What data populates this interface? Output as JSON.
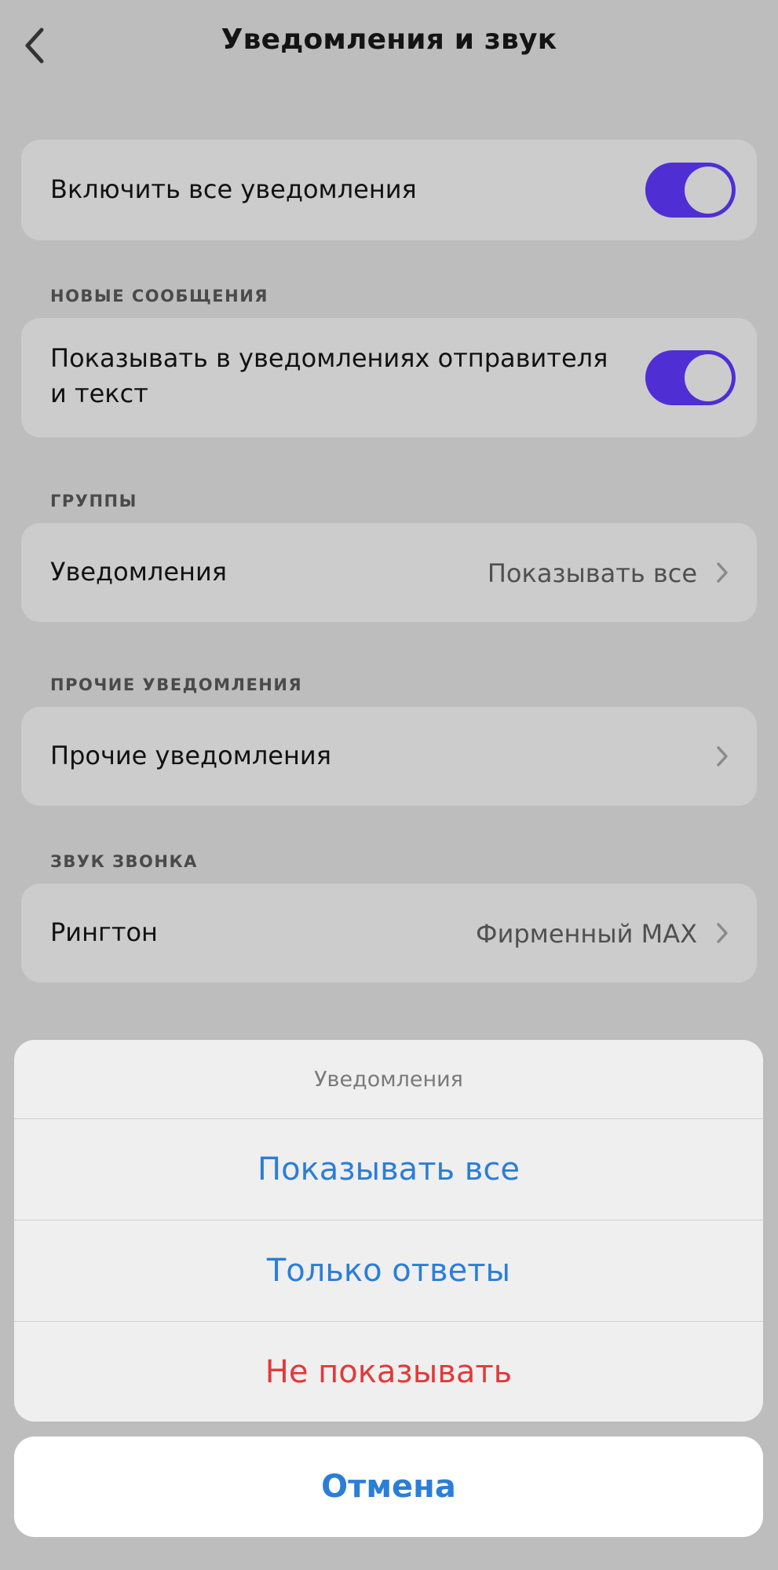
{
  "header": {
    "title": "Уведомления и звук"
  },
  "all_notifications": {
    "label": "Включить все уведомления",
    "enabled": true
  },
  "new_messages": {
    "section": "НОВЫЕ СООБЩЕНИЯ",
    "label_line1": "Показывать в уведомлениях отправителя",
    "label_line2": "и текст",
    "enabled": true
  },
  "groups": {
    "section": "ГРУППЫ",
    "label": "Уведомления",
    "value": "Показывать все"
  },
  "other": {
    "section": "ПРОЧИЕ УВЕДОМЛЕНИЯ",
    "label": "Прочие уведомления"
  },
  "call_sound": {
    "section": "ЗВУК ЗВОНКА",
    "label": "Рингтон",
    "value": "Фирменный MAX"
  },
  "action_sheet": {
    "title": "Уведомления",
    "options": [
      {
        "label": "Показывать все"
      },
      {
        "label": "Только ответы"
      },
      {
        "label": "Не показывать"
      }
    ],
    "cancel": "Отмена"
  },
  "colors": {
    "accent": "#4f2fd3",
    "link": "#2b7ed8",
    "destructive": "#e23a3a",
    "background": "#bdbdbd",
    "card": "#cccccc"
  },
  "icons": {
    "back": "chevron-left-icon",
    "row_arrow": "chevron-right-icon"
  }
}
